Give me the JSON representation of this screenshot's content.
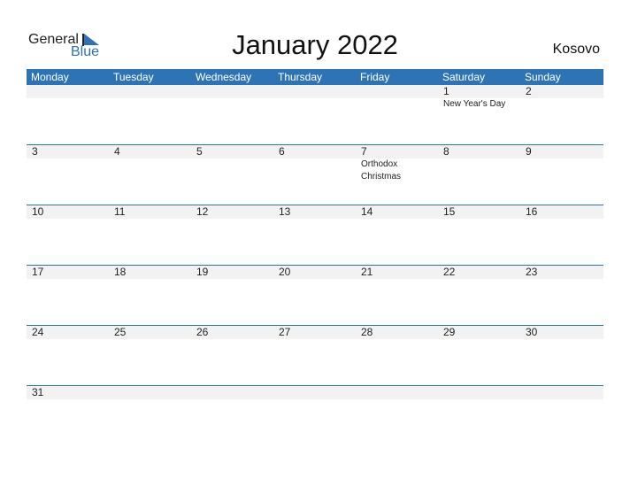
{
  "logo": {
    "general": "General",
    "blue": "Blue"
  },
  "title": "January 2022",
  "country": "Kosovo",
  "colors": {
    "accent": "#2e74b5",
    "band": "#f2f2f2"
  },
  "weekdays": [
    "Monday",
    "Tuesday",
    "Wednesday",
    "Thursday",
    "Friday",
    "Saturday",
    "Sunday"
  ],
  "weeks": [
    [
      {
        "d": ""
      },
      {
        "d": ""
      },
      {
        "d": ""
      },
      {
        "d": ""
      },
      {
        "d": ""
      },
      {
        "d": "1",
        "h": "New Year's Day"
      },
      {
        "d": "2"
      }
    ],
    [
      {
        "d": "3"
      },
      {
        "d": "4"
      },
      {
        "d": "5"
      },
      {
        "d": "6"
      },
      {
        "d": "7",
        "h": "Orthodox Christmas"
      },
      {
        "d": "8"
      },
      {
        "d": "9"
      }
    ],
    [
      {
        "d": "10"
      },
      {
        "d": "11"
      },
      {
        "d": "12"
      },
      {
        "d": "13"
      },
      {
        "d": "14"
      },
      {
        "d": "15"
      },
      {
        "d": "16"
      }
    ],
    [
      {
        "d": "17"
      },
      {
        "d": "18"
      },
      {
        "d": "19"
      },
      {
        "d": "20"
      },
      {
        "d": "21"
      },
      {
        "d": "22"
      },
      {
        "d": "23"
      }
    ],
    [
      {
        "d": "24"
      },
      {
        "d": "25"
      },
      {
        "d": "26"
      },
      {
        "d": "27"
      },
      {
        "d": "28"
      },
      {
        "d": "29"
      },
      {
        "d": "30"
      }
    ],
    [
      {
        "d": "31"
      },
      {
        "d": ""
      },
      {
        "d": ""
      },
      {
        "d": ""
      },
      {
        "d": ""
      },
      {
        "d": ""
      },
      {
        "d": ""
      }
    ]
  ]
}
